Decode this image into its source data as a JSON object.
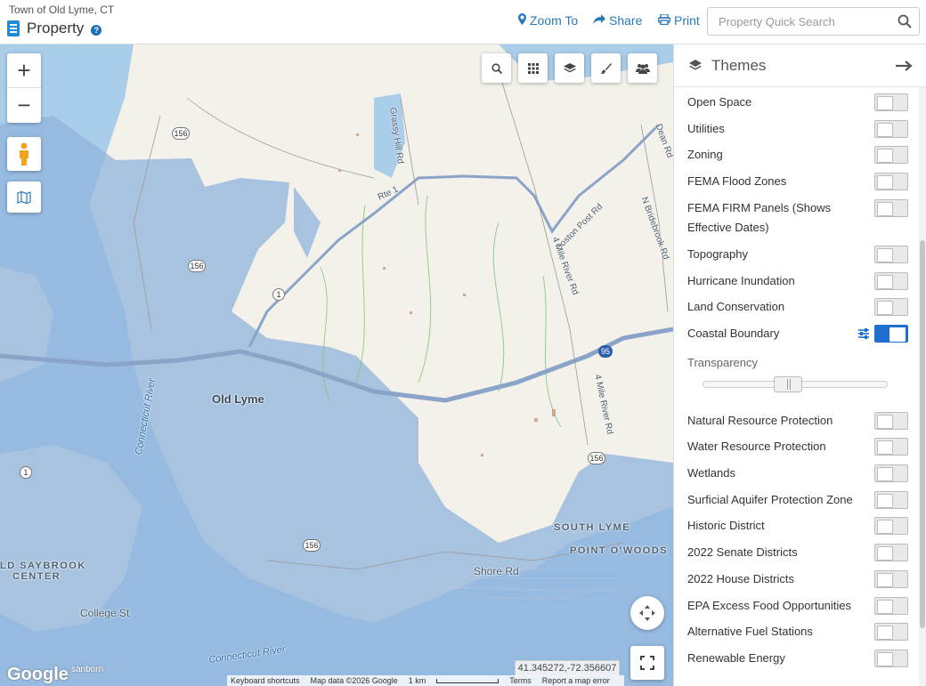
{
  "header": {
    "town": "Town of Old Lyme, CT",
    "title": "Property",
    "zoom_to": "Zoom To",
    "share": "Share",
    "print": "Print",
    "search_placeholder": "Property Quick Search"
  },
  "map": {
    "coordinates": "41.345272,-72.356607",
    "google": "Google",
    "sanborn": "sanborn",
    "attribution": {
      "shortcuts": "Keyboard shortcuts",
      "data": "Map data ©2026 Google",
      "scale": "1 km",
      "terms": "Terms",
      "report": "Report a map error"
    },
    "labels": {
      "town": "Old Lyme",
      "south_lyme": "SOUTH LYME",
      "point_o_woods": "POINT O'WOODS",
      "old_saybrook": "LD SAYBROOK",
      "center": "CENTER",
      "college_st": "College St",
      "connecticut_river_1": "Connecticut River",
      "connecticut_river_2": "Connecticut River",
      "shore_rd": "Shore Rd",
      "grassy_hill": "Grassy Hill Rd",
      "rte1": "Rte 1",
      "boston_post": "Boston Post Rd",
      "four_mile_1": "4 Mile River Rd",
      "four_mile_2": "4 Mile River Rd",
      "bridebrook": "N Bridebrook Rd",
      "dean_rd": "Dean Rd",
      "route_156": "156",
      "route_1": "1",
      "route_95": "95"
    }
  },
  "panel": {
    "title": "Themes",
    "layers": [
      {
        "label": "Open Space",
        "on": false
      },
      {
        "label": "Utilities",
        "on": false
      },
      {
        "label": "Zoning",
        "on": false
      },
      {
        "label": "FEMA Flood Zones",
        "on": false
      },
      {
        "label": "FEMA FIRM Panels (Shows Effective Dates)",
        "on": false
      },
      {
        "label": "Topography",
        "on": false
      },
      {
        "label": "Hurricane Inundation",
        "on": false
      },
      {
        "label": "Land Conservation",
        "on": false
      },
      {
        "label": "Coastal Boundary",
        "on": true
      },
      {
        "label": "Natural Resource Protection",
        "on": false
      },
      {
        "label": "Water Resource Protection",
        "on": false
      },
      {
        "label": "Wetlands",
        "on": false
      },
      {
        "label": "Surficial Aquifer Protection Zone",
        "on": false
      },
      {
        "label": "Historic District",
        "on": false
      },
      {
        "label": "2022 Senate Districts",
        "on": false
      },
      {
        "label": "2022 House Districts",
        "on": false
      },
      {
        "label": "EPA Excess Food Opportunities",
        "on": false
      },
      {
        "label": "Alternative Fuel Stations",
        "on": false
      },
      {
        "label": "Renewable Energy",
        "on": false
      }
    ],
    "transparency_label": "Transparency",
    "transparency_value": 0.45
  },
  "colors": {
    "accent": "#2a7ab9",
    "toggle_on": "#1e6fd0",
    "coastal_overlay": "#8fb3dc",
    "water": "#aacdea",
    "land": "#f3f1ea"
  }
}
